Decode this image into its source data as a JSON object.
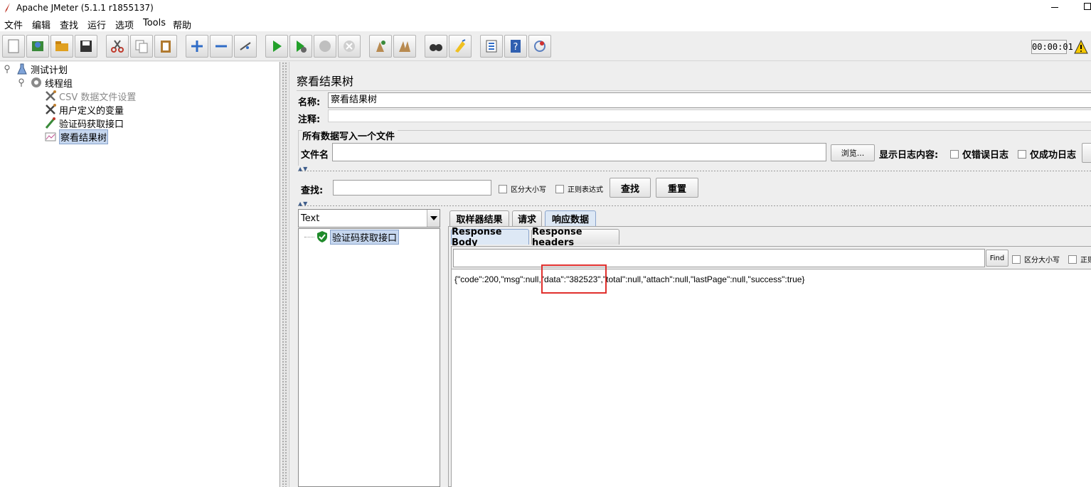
{
  "window": {
    "title": "Apache JMeter (5.1.1 r1855137)"
  },
  "menu": [
    "文件",
    "编辑",
    "查找",
    "运行",
    "选项",
    "Tools",
    "帮助"
  ],
  "toolbar": {
    "timer": "00:00:01",
    "icons": [
      "new-icon",
      "templates-icon",
      "open-icon",
      "save-icon",
      "cut-icon",
      "copy-icon",
      "paste-icon",
      "expand-icon",
      "collapse-icon",
      "toggle-icon",
      "start-icon",
      "start-no-pause-icon",
      "stop-icon",
      "shutdown-icon",
      "clear-icon",
      "clear-all-icon",
      "search-icon",
      "reset-search-icon",
      "function-helper-icon",
      "help-icon",
      "remote-icon"
    ]
  },
  "tree": {
    "nodes": [
      {
        "label": "测试计划",
        "icon": "test-plan-icon",
        "disabled": false,
        "selected": false
      },
      {
        "label": "线程组",
        "icon": "thread-group-icon",
        "disabled": false,
        "selected": false
      },
      {
        "label": "CSV 数据文件设置",
        "icon": "config-icon",
        "disabled": true,
        "selected": false
      },
      {
        "label": "用户定义的变量",
        "icon": "config-icon",
        "disabled": false,
        "selected": false
      },
      {
        "label": "验证码获取接口",
        "icon": "sampler-icon",
        "disabled": false,
        "selected": false
      },
      {
        "label": "察看结果树",
        "icon": "listener-icon",
        "disabled": false,
        "selected": true
      }
    ]
  },
  "panel": {
    "title": "察看结果树",
    "name_label": "名称:",
    "name_value": "察看结果树",
    "comment_label": "注释:",
    "comment_value": "",
    "file_section_label": "所有数据写入一个文件",
    "filename_label": "文件名",
    "filename_value": "",
    "browse_button": "浏览...",
    "log_label": "显示日志内容:",
    "errors_only": "仅错误日志",
    "success_only": "仅成功日志"
  },
  "search": {
    "label": "查找:",
    "value": "",
    "case_sensitive": "区分大小写",
    "regex": "正则表达式",
    "search_button": "查找",
    "reset_button": "重置"
  },
  "results": {
    "renderer": "Text",
    "items": [
      {
        "label": "验证码获取接口",
        "status": "success"
      }
    ],
    "tabs": [
      "取样器结果",
      "请求",
      "响应数据"
    ],
    "active_tab": "响应数据",
    "subtabs": [
      "Response Body",
      "Response headers"
    ],
    "active_subtab": "Response Body",
    "find_button": "Find",
    "find_case": "区分大小写",
    "find_regex_partial": "正则",
    "response_text": "{\"code\":200,\"msg\":null,\"data\":\"382523\",\"total\":null,\"attach\":null,\"lastPage\":null,\"success\":true}"
  },
  "colors": {
    "highlight_box": "#e0302d",
    "selection": "#c6d7ef"
  }
}
